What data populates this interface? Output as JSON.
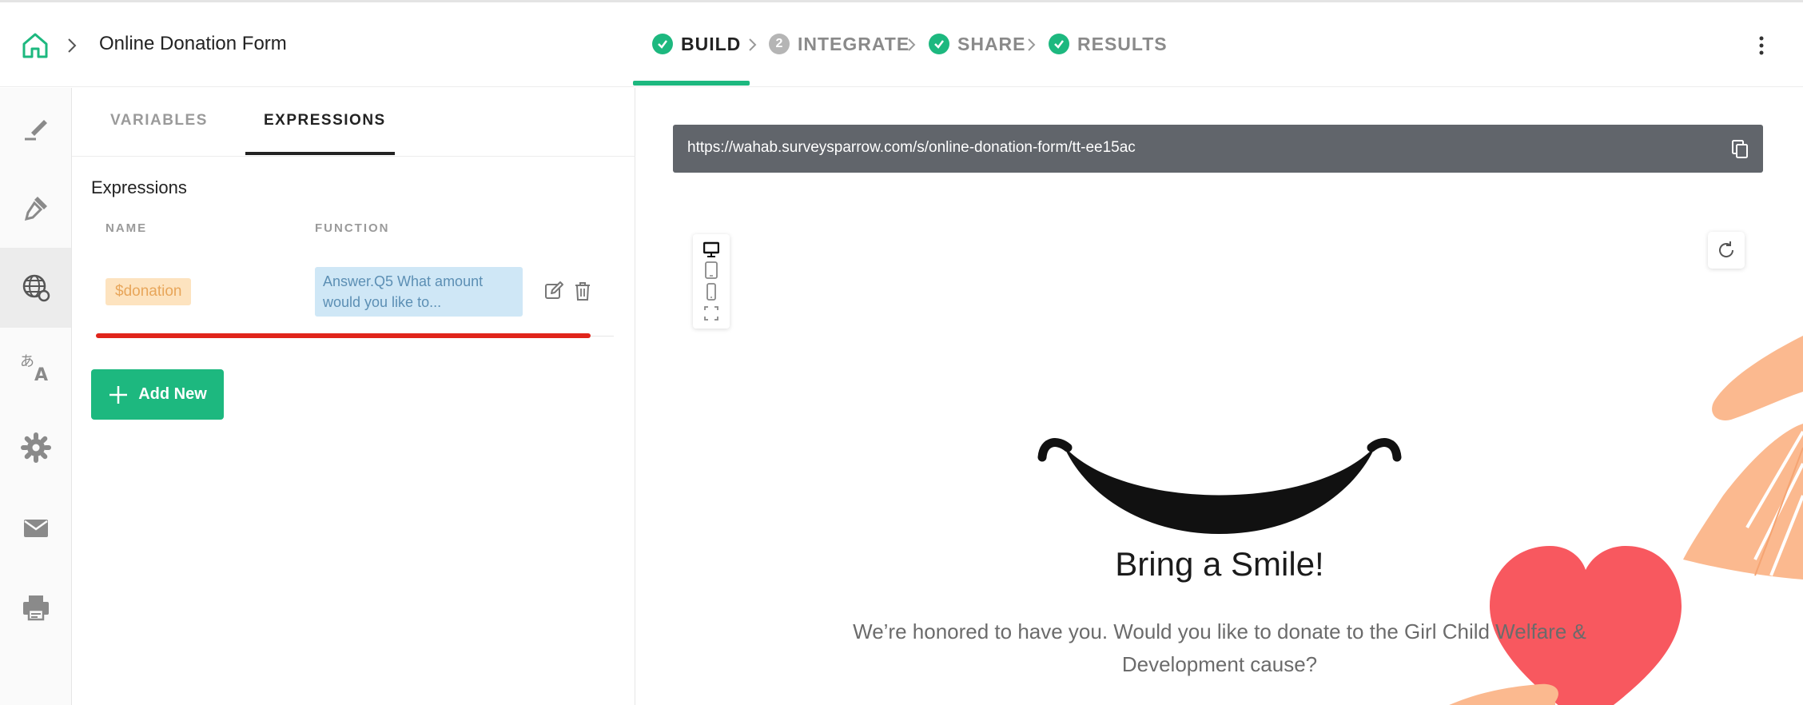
{
  "header": {
    "breadcrumb_title": "Online Donation Form",
    "steps": [
      {
        "label": "BUILD",
        "state": "done"
      },
      {
        "label": "INTEGRATE",
        "state": "pending",
        "number": "2"
      },
      {
        "label": "SHARE",
        "state": "done"
      },
      {
        "label": "RESULTS",
        "state": "done"
      }
    ]
  },
  "rail": {
    "items": [
      "brush-pen-icon",
      "paint-icon",
      "globe-settings-icon",
      "translate-icon",
      "gear-icon",
      "mail-icon",
      "print-icon"
    ],
    "active_index": 2
  },
  "panel": {
    "tabs": [
      {
        "label": "VARIABLES",
        "active": false
      },
      {
        "label": "EXPRESSIONS",
        "active": true
      }
    ],
    "section_title": "Expressions",
    "columns": {
      "name": "NAME",
      "function": "FUNCTION"
    },
    "rows": [
      {
        "name": "$donation",
        "function": "Answer.Q5 What amount would you like to..."
      }
    ],
    "add_button_label": "Add New"
  },
  "preview": {
    "url": "https://wahab.surveysparrow.com/s/online-donation-form/tt-ee15ac",
    "welcome_title": "Bring a Smile!",
    "welcome_text": "We’re honored to have you. Would you like to donate to the Girl Child Welfare & Development cause?"
  },
  "colors": {
    "accent": "#1db87f",
    "url_bar": "#61656b",
    "variable_chip_bg": "#fde3bf",
    "function_box_bg": "#cfe7f6",
    "highlight_red": "#e0251b",
    "heart": "#f8585f",
    "hand": "#fbb98f"
  }
}
